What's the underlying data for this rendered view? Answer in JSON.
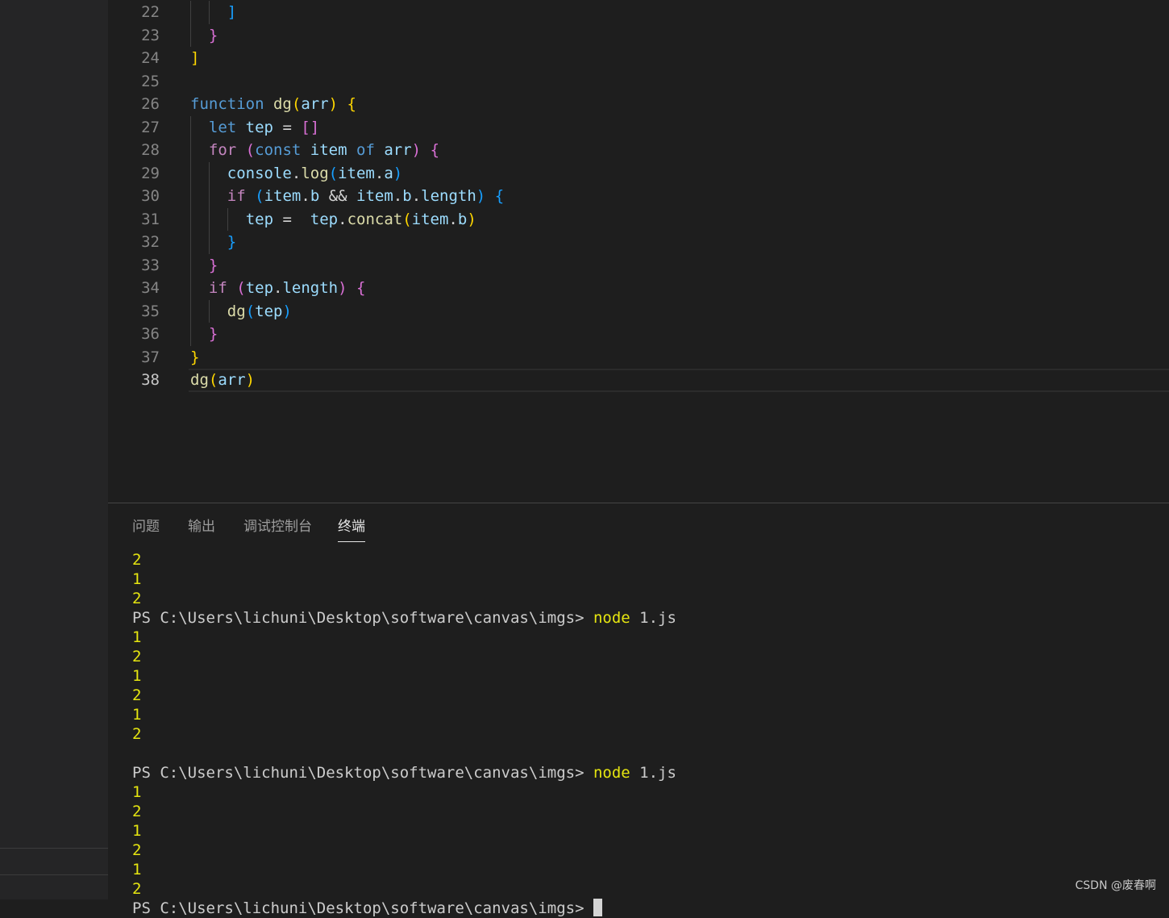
{
  "editor": {
    "lines": [
      {
        "n": "22",
        "tokens": [
          {
            "t": "]",
            "c": "b3"
          }
        ],
        "indent": 4
      },
      {
        "n": "23",
        "tokens": [
          {
            "t": "}",
            "c": "b2"
          }
        ],
        "indent": 2
      },
      {
        "n": "24",
        "tokens": [
          {
            "t": "]",
            "c": "b1"
          }
        ],
        "indent": 0
      },
      {
        "n": "25",
        "tokens": [],
        "indent": 0
      },
      {
        "n": "26",
        "tokens": [
          {
            "t": "function",
            "c": "kw"
          },
          {
            "t": " ",
            "c": "op"
          },
          {
            "t": "dg",
            "c": "fn"
          },
          {
            "t": "(",
            "c": "b1"
          },
          {
            "t": "arr",
            "c": "var"
          },
          {
            "t": ")",
            "c": "b1"
          },
          {
            "t": " ",
            "c": "op"
          },
          {
            "t": "{",
            "c": "b1"
          }
        ],
        "indent": 0
      },
      {
        "n": "27",
        "tokens": [
          {
            "t": "let",
            "c": "kw"
          },
          {
            "t": " ",
            "c": "op"
          },
          {
            "t": "tep",
            "c": "var"
          },
          {
            "t": " = ",
            "c": "op"
          },
          {
            "t": "[]",
            "c": "b2"
          }
        ],
        "indent": 2
      },
      {
        "n": "28",
        "tokens": [
          {
            "t": "for",
            "c": "ctl"
          },
          {
            "t": " ",
            "c": "op"
          },
          {
            "t": "(",
            "c": "b2"
          },
          {
            "t": "const",
            "c": "kw"
          },
          {
            "t": " ",
            "c": "op"
          },
          {
            "t": "item",
            "c": "var"
          },
          {
            "t": " ",
            "c": "op"
          },
          {
            "t": "of",
            "c": "kw"
          },
          {
            "t": " ",
            "c": "op"
          },
          {
            "t": "arr",
            "c": "var"
          },
          {
            "t": ")",
            "c": "b2"
          },
          {
            "t": " ",
            "c": "op"
          },
          {
            "t": "{",
            "c": "b2"
          }
        ],
        "indent": 2
      },
      {
        "n": "29",
        "tokens": [
          {
            "t": "console",
            "c": "var"
          },
          {
            "t": ".",
            "c": "op"
          },
          {
            "t": "log",
            "c": "fn"
          },
          {
            "t": "(",
            "c": "b3"
          },
          {
            "t": "item",
            "c": "var"
          },
          {
            "t": ".",
            "c": "op"
          },
          {
            "t": "a",
            "c": "var"
          },
          {
            "t": ")",
            "c": "b3"
          }
        ],
        "indent": 4
      },
      {
        "n": "30",
        "tokens": [
          {
            "t": "if",
            "c": "ctl"
          },
          {
            "t": " ",
            "c": "op"
          },
          {
            "t": "(",
            "c": "b3"
          },
          {
            "t": "item",
            "c": "var"
          },
          {
            "t": ".",
            "c": "op"
          },
          {
            "t": "b",
            "c": "var"
          },
          {
            "t": " && ",
            "c": "op"
          },
          {
            "t": "item",
            "c": "var"
          },
          {
            "t": ".",
            "c": "op"
          },
          {
            "t": "b",
            "c": "var"
          },
          {
            "t": ".",
            "c": "op"
          },
          {
            "t": "length",
            "c": "var"
          },
          {
            "t": ")",
            "c": "b3"
          },
          {
            "t": " ",
            "c": "op"
          },
          {
            "t": "{",
            "c": "b3"
          }
        ],
        "indent": 4
      },
      {
        "n": "31",
        "tokens": [
          {
            "t": "tep",
            "c": "var"
          },
          {
            "t": " =  ",
            "c": "op"
          },
          {
            "t": "tep",
            "c": "var"
          },
          {
            "t": ".",
            "c": "op"
          },
          {
            "t": "concat",
            "c": "fn"
          },
          {
            "t": "(",
            "c": "b1"
          },
          {
            "t": "item",
            "c": "var"
          },
          {
            "t": ".",
            "c": "op"
          },
          {
            "t": "b",
            "c": "var"
          },
          {
            "t": ")",
            "c": "b1"
          }
        ],
        "indent": 6
      },
      {
        "n": "32",
        "tokens": [
          {
            "t": "}",
            "c": "b3"
          }
        ],
        "indent": 4
      },
      {
        "n": "33",
        "tokens": [
          {
            "t": "}",
            "c": "b2"
          }
        ],
        "indent": 2
      },
      {
        "n": "34",
        "tokens": [
          {
            "t": "if",
            "c": "ctl"
          },
          {
            "t": " ",
            "c": "op"
          },
          {
            "t": "(",
            "c": "b2"
          },
          {
            "t": "tep",
            "c": "var"
          },
          {
            "t": ".",
            "c": "op"
          },
          {
            "t": "length",
            "c": "var"
          },
          {
            "t": ")",
            "c": "b2"
          },
          {
            "t": " ",
            "c": "op"
          },
          {
            "t": "{",
            "c": "b2"
          }
        ],
        "indent": 2
      },
      {
        "n": "35",
        "tokens": [
          {
            "t": "dg",
            "c": "fn"
          },
          {
            "t": "(",
            "c": "b3"
          },
          {
            "t": "tep",
            "c": "var"
          },
          {
            "t": ")",
            "c": "b3"
          }
        ],
        "indent": 4
      },
      {
        "n": "36",
        "tokens": [
          {
            "t": "}",
            "c": "b2"
          }
        ],
        "indent": 2
      },
      {
        "n": "37",
        "tokens": [
          {
            "t": "}",
            "c": "b1"
          }
        ],
        "indent": 0
      },
      {
        "n": "38",
        "tokens": [
          {
            "t": "dg",
            "c": "fn"
          },
          {
            "t": "(",
            "c": "b1"
          },
          {
            "t": "arr",
            "c": "var"
          },
          {
            "t": ")",
            "c": "b1"
          }
        ],
        "indent": 0,
        "current": true
      }
    ]
  },
  "panel": {
    "tabs": [
      {
        "label": "问题",
        "active": false
      },
      {
        "label": "输出",
        "active": false
      },
      {
        "label": "调试控制台",
        "active": false
      },
      {
        "label": "终端",
        "active": true
      }
    ],
    "terminal": {
      "prompt": "PS C:\\Users\\lichuni\\Desktop\\software\\canvas\\imgs> ",
      "lines": [
        {
          "type": "out",
          "text": "2"
        },
        {
          "type": "out",
          "text": "1"
        },
        {
          "type": "out",
          "text": "2"
        },
        {
          "type": "cmd",
          "cmd": "node",
          "arg": " 1.js"
        },
        {
          "type": "out",
          "text": "1"
        },
        {
          "type": "out",
          "text": "2"
        },
        {
          "type": "out",
          "text": "1"
        },
        {
          "type": "out",
          "text": "2"
        },
        {
          "type": "out",
          "text": "1"
        },
        {
          "type": "out",
          "text": "2"
        },
        {
          "type": "blank",
          "text": ""
        },
        {
          "type": "cmd",
          "cmd": "node",
          "arg": " 1.js"
        },
        {
          "type": "out",
          "text": "1"
        },
        {
          "type": "out",
          "text": "2"
        },
        {
          "type": "out",
          "text": "1"
        },
        {
          "type": "out",
          "text": "2"
        },
        {
          "type": "out",
          "text": "1"
        },
        {
          "type": "out",
          "text": "2"
        },
        {
          "type": "prompt",
          "text": ""
        }
      ]
    }
  },
  "watermark": "CSDN @废春啊"
}
